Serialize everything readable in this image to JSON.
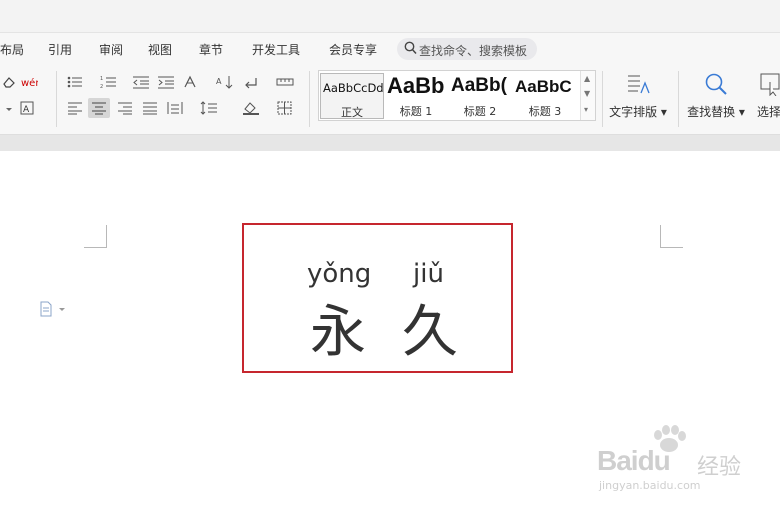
{
  "menu": {
    "items": [
      "布局",
      "引用",
      "审阅",
      "视图",
      "章节",
      "开发工具",
      "会员专享"
    ],
    "search_placeholder": "查找命令、搜索模板"
  },
  "styles": {
    "normal": {
      "sample": "AaBbCcDd",
      "name": "正文"
    },
    "heading1": {
      "sample": "AaBb",
      "name": "标题 1"
    },
    "heading2": {
      "sample": "AaBb(",
      "name": "标题 2"
    },
    "heading3": {
      "sample": "AaBbC",
      "name": "标题 3"
    }
  },
  "ribbon": {
    "text_layout_label": "文字排版",
    "find_replace_label": "查找替换",
    "select_label": "选择"
  },
  "document": {
    "pinyin": [
      "yǒng",
      "jiǔ"
    ],
    "hanzi": [
      "永",
      "久"
    ]
  },
  "watermark": {
    "brand": "Baidu",
    "cn": "经验",
    "url": "jingyan.baidu.com"
  },
  "colors": {
    "frame_border": "#c6262e",
    "ribbon_bg": "#f7f7f7"
  }
}
